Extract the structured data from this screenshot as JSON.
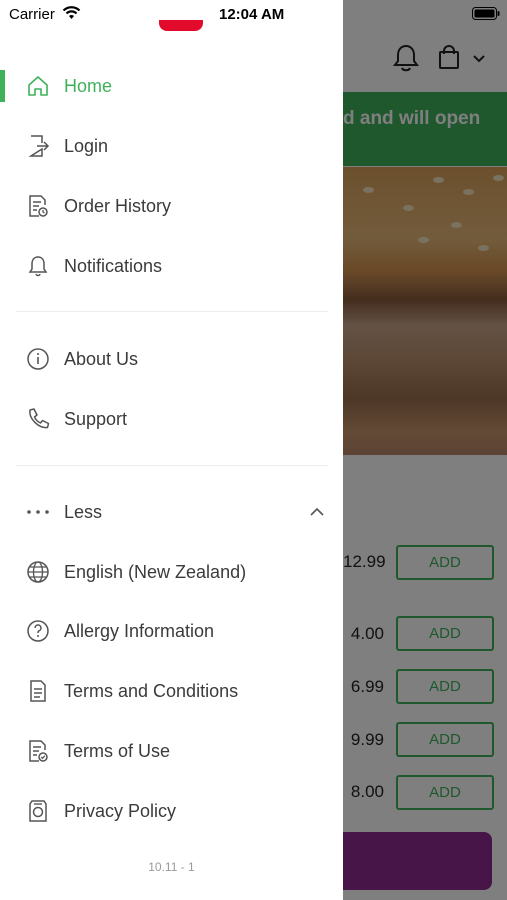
{
  "status_bar": {
    "carrier": "Carrier",
    "time": "12:04 AM"
  },
  "drawer": {
    "items": [
      {
        "label": "Home",
        "icon": "home-icon",
        "active": true
      },
      {
        "label": "Login",
        "icon": "login-icon"
      },
      {
        "label": "Order History",
        "icon": "order-history-icon"
      },
      {
        "label": "Notifications",
        "icon": "bell-icon"
      },
      {
        "label": "About Us",
        "icon": "info-icon"
      },
      {
        "label": "Support",
        "icon": "phone-icon"
      },
      {
        "label": "Less",
        "icon": "more-dots-icon"
      },
      {
        "label": "English (New Zealand)",
        "icon": "globe-icon"
      },
      {
        "label": "Allergy Information",
        "icon": "question-icon"
      },
      {
        "label": "Terms and Conditions",
        "icon": "document-icon"
      },
      {
        "label": "Terms of Use",
        "icon": "document-check-icon"
      },
      {
        "label": "Privacy Policy",
        "icon": "privacy-icon"
      }
    ],
    "version": "10.11 - 1",
    "accent_color": "#3fb15b"
  },
  "background": {
    "banner_text": "d and will open",
    "menu_rows": [
      {
        "price": "12.99",
        "add_label": "ADD"
      },
      {
        "price": "4.00",
        "add_label": "ADD"
      },
      {
        "price": "6.99",
        "add_label": "ADD"
      },
      {
        "price": "9.99",
        "add_label": "ADD"
      },
      {
        "price": "8.00",
        "add_label": "ADD"
      }
    ],
    "cart_color": "#8f2b91"
  }
}
